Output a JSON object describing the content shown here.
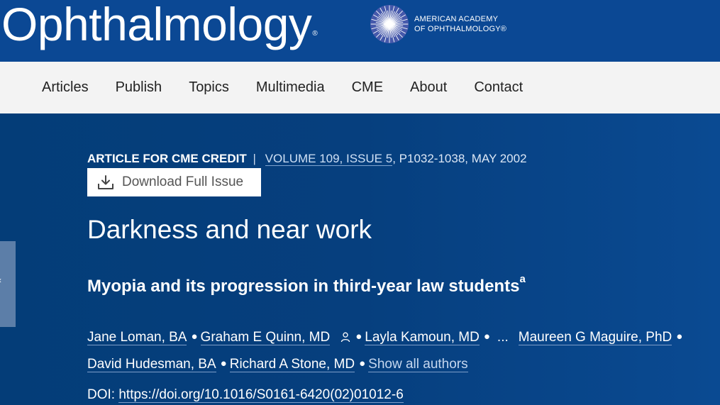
{
  "brand": {
    "journal_name": "Ophthalmology",
    "trademark": "®",
    "aao_line1": "AMERICAN ACADEMY",
    "aao_line2": "OF OPHTHALMOLOGY®"
  },
  "nav": {
    "items": [
      "Articles",
      "Publish",
      "Topics",
      "Multimedia",
      "CME",
      "About",
      "Contact"
    ]
  },
  "article": {
    "type": "ARTICLE FOR CME CREDIT",
    "separator": "|",
    "volume_issue": "VOLUME 109, ISSUE 5",
    "pages_date": ", P1032-1038, MAY 2002",
    "download_label": "Download Full Issue",
    "title": "Darkness and near work",
    "subtitle": "Myopia and its progression in third-year law students",
    "subtitle_sup": "a",
    "authors": [
      "Jane Loman, BA",
      "Graham E Quinn, MD",
      "Layla Kamoun, MD",
      "Maureen G Maguire, PhD",
      "David Hudesman, BA",
      "Richard A Stone, MD"
    ],
    "ellipsis": "...",
    "show_all_label": "Show all authors",
    "doi_label": "DOI:",
    "doi_url": "https://doi.org/10.1016/S0161-6420(02)01012-6"
  },
  "icons": {
    "download": "download-icon",
    "person": "person-icon",
    "side_tab_arrow": "chevron-left-icon",
    "logo": "aao-starburst-logo"
  },
  "colors": {
    "brand_blue": "#0b4894",
    "hero_blue": "#063f7e",
    "nav_bg": "#f3f3f3",
    "logo_purple": "#b47ad6"
  }
}
